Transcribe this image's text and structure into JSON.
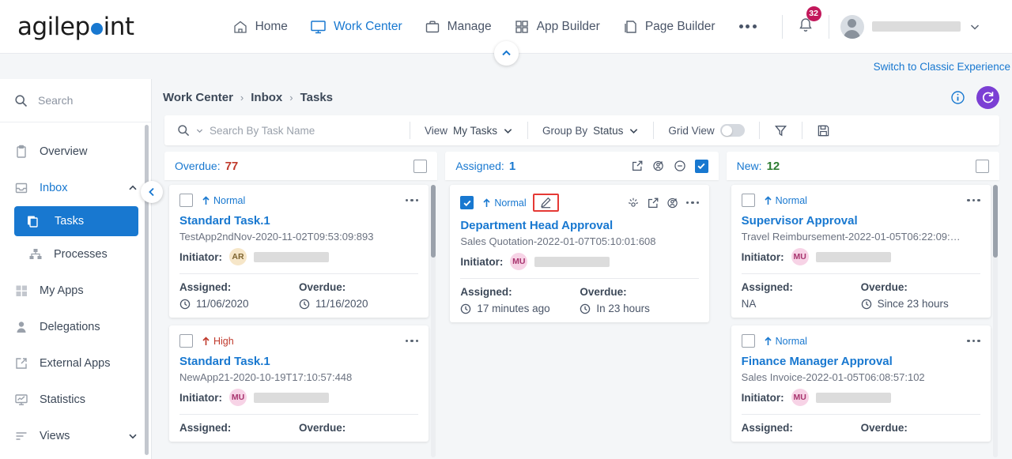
{
  "brand": {
    "name_part1": "agilep",
    "name_part2": "int",
    "dot_color": "#1878d0"
  },
  "topnav": {
    "items": [
      {
        "label": "Home",
        "icon": "home-icon",
        "active": false
      },
      {
        "label": "Work Center",
        "icon": "monitor-icon",
        "active": true
      },
      {
        "label": "Manage",
        "icon": "briefcase-icon",
        "active": false
      },
      {
        "label": "App Builder",
        "icon": "grid-icon",
        "active": false
      },
      {
        "label": "Page Builder",
        "icon": "pages-icon",
        "active": false
      }
    ],
    "more_label": "•••",
    "notification_count": "32",
    "user_name": ""
  },
  "subbar": {
    "classic_link": "Switch to Classic Experience"
  },
  "sidebar": {
    "search_placeholder": "Search",
    "items": [
      {
        "label": "Overview",
        "icon": "clipboard-icon",
        "state": "normal",
        "chevron": ""
      },
      {
        "label": "Inbox",
        "icon": "inbox-icon",
        "state": "link",
        "chevron": "up"
      },
      {
        "label": "Tasks",
        "icon": "tasks-icon",
        "state": "active",
        "chevron": ""
      },
      {
        "label": "Processes",
        "icon": "processes-icon",
        "state": "sub",
        "chevron": ""
      },
      {
        "label": "My Apps",
        "icon": "apps-icon",
        "state": "normal",
        "chevron": ""
      },
      {
        "label": "Delegations",
        "icon": "person-icon",
        "state": "normal",
        "chevron": ""
      },
      {
        "label": "External Apps",
        "icon": "external-link-icon",
        "state": "normal",
        "chevron": ""
      },
      {
        "label": "Statistics",
        "icon": "statistics-icon",
        "state": "normal",
        "chevron": ""
      },
      {
        "label": "Views",
        "icon": "views-icon",
        "state": "normal",
        "chevron": "down"
      }
    ]
  },
  "breadcrumb": {
    "crumb1": "Work Center",
    "crumb2": "Inbox",
    "crumb3": "Tasks",
    "sep": "›"
  },
  "toolbar": {
    "search_placeholder": "Search By Task Name",
    "view_label": "View",
    "view_value": "My Tasks",
    "groupby_label": "Group By",
    "groupby_value": "Status",
    "gridview_label": "Grid View",
    "filter_icon": "funnel-icon",
    "save_icon": "save-icon"
  },
  "columns": [
    {
      "title": "Overdue:",
      "count": "77",
      "count_color": "#c0392b",
      "header_icons": [
        "checkbox"
      ],
      "header_checked": false,
      "cards": [
        {
          "checked": false,
          "priority": "Normal",
          "priority_class": "normal",
          "show_edit_highlight": false,
          "icons": [
            "dots"
          ],
          "title": "Standard Task.1",
          "subtitle": "TestApp2ndNov-2020-11-02T09:53:09:893",
          "initiator_label": "Initiator:",
          "initiator_initials": "AR",
          "initiator_class": "ar",
          "assigned_label": "Assigned:",
          "assigned_value": "11/06/2020",
          "assigned_has_clock": true,
          "overdue_label": "Overdue:",
          "overdue_value": "11/16/2020",
          "overdue_has_clock": true
        },
        {
          "checked": false,
          "priority": "High",
          "priority_class": "high",
          "show_edit_highlight": false,
          "icons": [
            "dots"
          ],
          "title": "Standard Task.1",
          "subtitle": "NewApp21-2020-10-19T17:10:57:448",
          "initiator_label": "Initiator:",
          "initiator_initials": "MU",
          "initiator_class": "mu",
          "assigned_label": "Assigned:",
          "assigned_value": "",
          "assigned_has_clock": false,
          "overdue_label": "Overdue:",
          "overdue_value": "",
          "overdue_has_clock": false
        }
      ],
      "scroll_thumb_top": 0,
      "scroll_thumb_height": 92,
      "show_scroll": true
    },
    {
      "title": "Assigned:",
      "count": "1",
      "count_color": "#1878d0",
      "header_icons": [
        "export",
        "reassign",
        "minus",
        "checkbox-checked"
      ],
      "header_checked": true,
      "cards": [
        {
          "checked": true,
          "priority": "Normal",
          "priority_class": "normal",
          "show_edit_highlight": true,
          "icons": [
            "settings",
            "export",
            "reassign",
            "dots"
          ],
          "title": "Department Head Approval",
          "subtitle": "Sales Quotation-2022-01-07T05:10:01:608",
          "initiator_label": "Initiator:",
          "initiator_initials": "MU",
          "initiator_class": "mu",
          "assigned_label": "Assigned:",
          "assigned_value": "17 minutes ago",
          "assigned_has_clock": true,
          "overdue_label": "Overdue:",
          "overdue_value": "In 23 hours",
          "overdue_has_clock": true
        }
      ],
      "scroll_thumb_top": 0,
      "scroll_thumb_height": 0,
      "show_scroll": false
    },
    {
      "title": "New:",
      "count": "12",
      "count_color": "#2e7d32",
      "header_icons": [
        "checkbox"
      ],
      "header_checked": false,
      "cards": [
        {
          "checked": false,
          "priority": "Normal",
          "priority_class": "normal",
          "show_edit_highlight": false,
          "icons": [
            "dots"
          ],
          "title": "Supervisor Approval",
          "subtitle": "Travel Reimbursement-2022-01-05T06:22:09:…",
          "initiator_label": "Initiator:",
          "initiator_initials": "MU",
          "initiator_class": "mu",
          "assigned_label": "Assigned:",
          "assigned_value": "NA",
          "assigned_has_clock": false,
          "overdue_label": "Overdue:",
          "overdue_value": "Since 23 hours",
          "overdue_has_clock": true
        },
        {
          "checked": false,
          "priority": "Normal",
          "priority_class": "normal",
          "show_edit_highlight": false,
          "icons": [
            "dots"
          ],
          "title": "Finance Manager Approval",
          "subtitle": "Sales Invoice-2022-01-05T06:08:57:102",
          "initiator_label": "Initiator:",
          "initiator_initials": "MU",
          "initiator_class": "mu",
          "assigned_label": "Assigned:",
          "assigned_value": "",
          "assigned_has_clock": false,
          "overdue_label": "Overdue:",
          "overdue_value": "",
          "overdue_has_clock": false
        }
      ],
      "scroll_thumb_top": 0,
      "scroll_thumb_height": 92,
      "show_scroll": true
    }
  ]
}
